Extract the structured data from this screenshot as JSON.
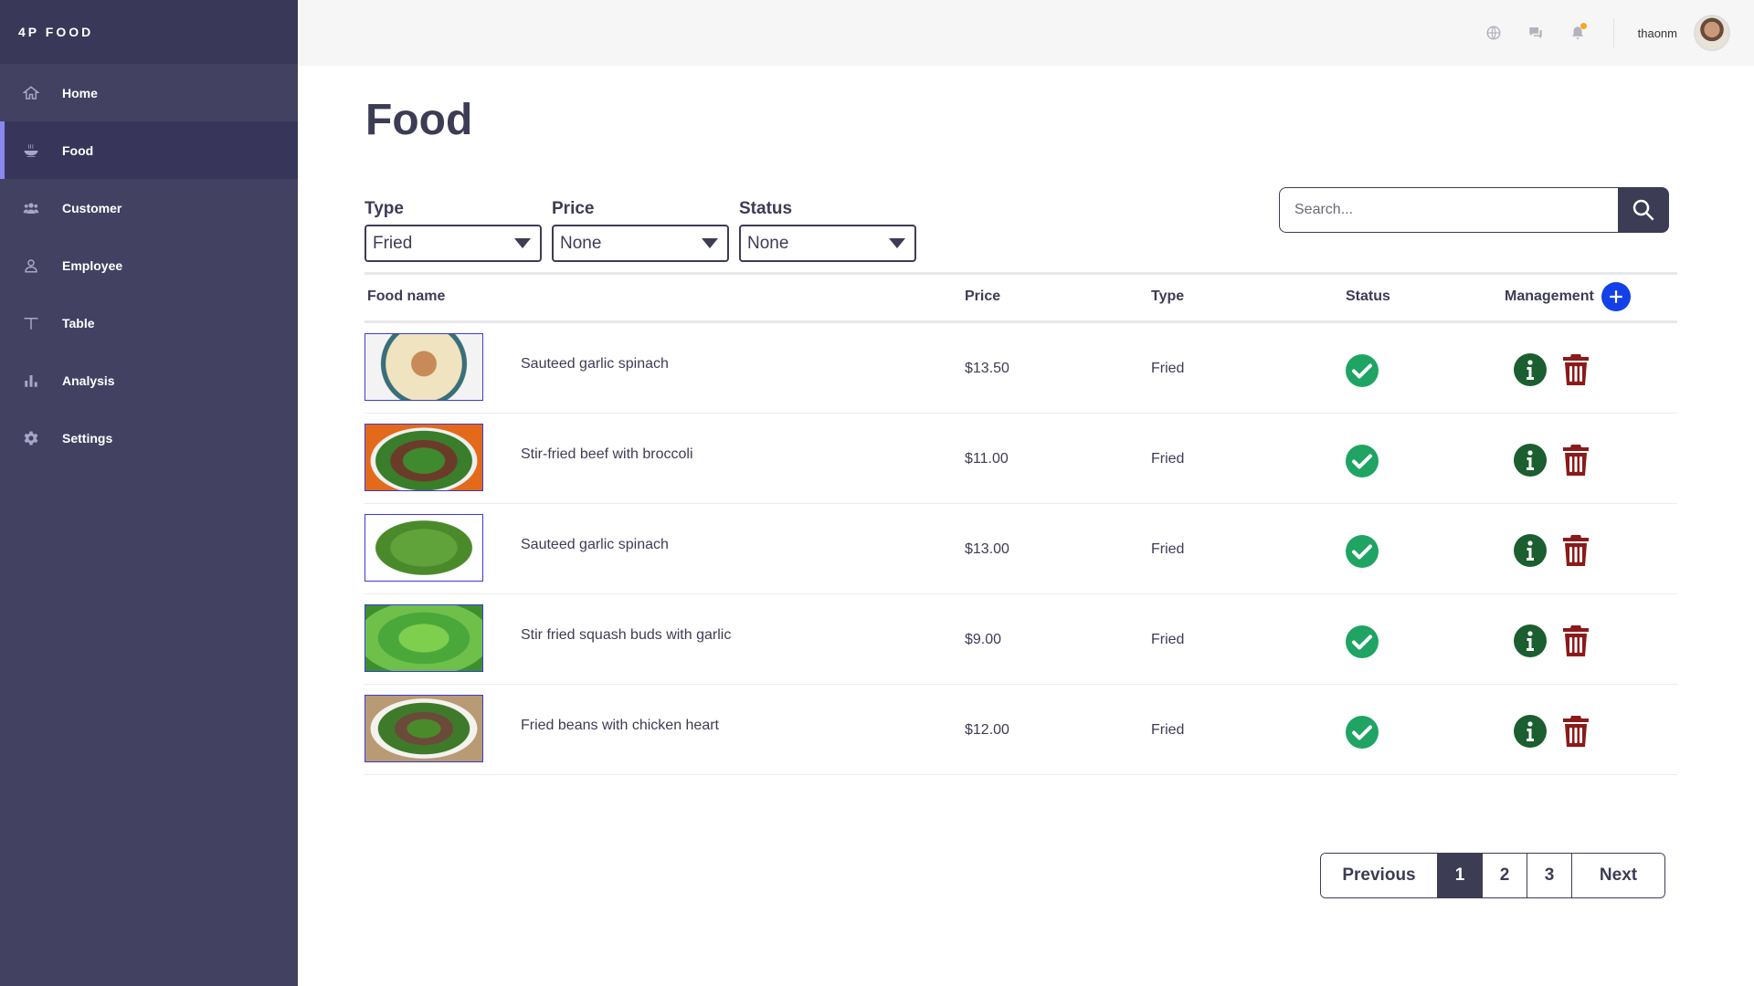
{
  "brand": "4P FOOD",
  "sidebar": {
    "items": [
      {
        "label": "Home",
        "icon": "home-icon"
      },
      {
        "label": "Food",
        "icon": "bowl-icon"
      },
      {
        "label": "Customer",
        "icon": "users-icon"
      },
      {
        "label": "Employee",
        "icon": "user-icon"
      },
      {
        "label": "Table",
        "icon": "table-icon"
      },
      {
        "label": "Analysis",
        "icon": "bar-chart-icon"
      },
      {
        "label": "Settings",
        "icon": "gear-icon"
      }
    ],
    "active": "Food"
  },
  "topbar": {
    "icons": [
      "globe-icon",
      "chat-icon",
      "bell-icon"
    ],
    "username": "thaonm"
  },
  "page": {
    "title": "Food"
  },
  "filters": {
    "type": {
      "label": "Type",
      "value": "Fried"
    },
    "price": {
      "label": "Price",
      "value": "None"
    },
    "status": {
      "label": "Status",
      "value": "None"
    }
  },
  "search": {
    "placeholder": "Search..."
  },
  "table": {
    "headers": {
      "name": "Food name",
      "price": "Price",
      "type": "Type",
      "status": "Status",
      "management": "Management"
    },
    "rows": [
      {
        "name": "Sauteed garlic spinach",
        "price": "$13.50",
        "type": "Fried",
        "status": "available"
      },
      {
        "name": "Stir-fried beef with broccoli",
        "price": "$11.00",
        "type": "Fried",
        "status": "available"
      },
      {
        "name": "Sauteed garlic spinach",
        "price": "$13.00",
        "type": "Fried",
        "status": "available"
      },
      {
        "name": "Stir fried squash buds with garlic",
        "price": "$9.00",
        "type": "Fried",
        "status": "available"
      },
      {
        "name": "Fried beans with chicken heart",
        "price": "$12.00",
        "type": "Fried",
        "status": "available"
      }
    ]
  },
  "pagination": {
    "previous": "Previous",
    "pages": [
      "1",
      "2",
      "3"
    ],
    "current": "1",
    "next": "Next"
  },
  "colors": {
    "sidebar": "#424162",
    "accent": "#8b87f0",
    "primary": "#3d3c55",
    "add": "#1340e8",
    "status_ok": "#1fa463",
    "info": "#1b5e2f",
    "delete": "#8b1a1a",
    "notification": "#f5a623"
  }
}
